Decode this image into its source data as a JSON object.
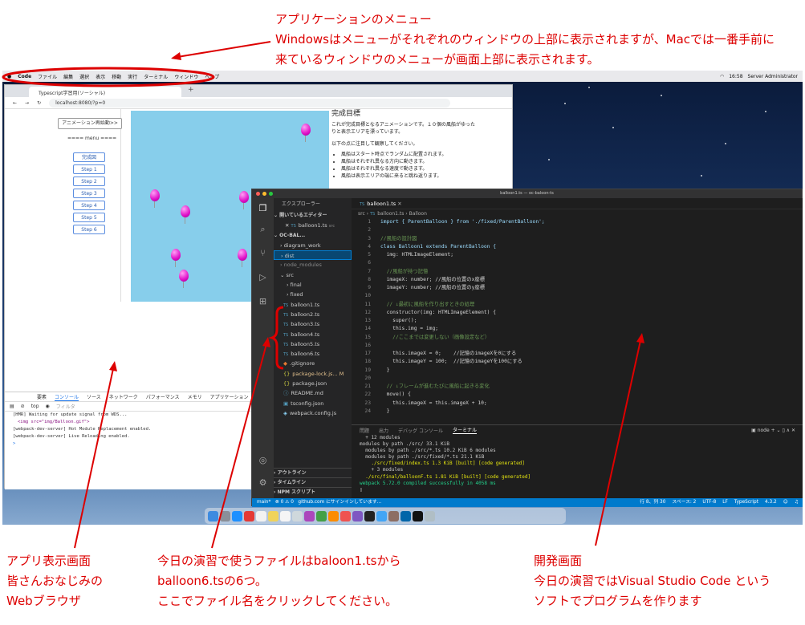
{
  "annotations": {
    "menu_title": "アプリケーションのメニュー",
    "menu_desc1": "Windowsはメニューがそれぞれのウィンドウの上部に表示されますが、Macでは一番手前に",
    "menu_desc2": "来ているウィンドウのメニューが画面上部に表示されます。",
    "browser_line1": "アプリ表示画面",
    "browser_line2": "皆さんおなじみの",
    "browser_line3": "Webブラウザ",
    "files_line1": "今日の演習で使うファイルはbaloon1.tsから",
    "files_line2": "balloon6.tsの6つ。",
    "files_line3": "ここでファイル名をクリックしてください。",
    "dev_line1": "開発画面",
    "dev_line2": "今日の演習ではVisual Studio Code という",
    "dev_line3": "ソフトでプログラムを作ります",
    "accent_color": "#dd0000"
  },
  "menubar": {
    "app": "Code",
    "items": [
      "ファイル",
      "編集",
      "選択",
      "表示",
      "移動",
      "実行",
      "ターミナル",
      "ウィンドウ",
      "ヘルプ"
    ],
    "time": "16:58",
    "user": "Server Administrator"
  },
  "browser": {
    "tab_title": "Typescript学習用(ソーシャル)",
    "url": "localhost:8080/?p=0",
    "restart_button": "アニメーション再始動>>",
    "menu_heading": "==== menu ====",
    "menu_buttons": [
      "完成図",
      "Step 1",
      "Step 2",
      "Step 3",
      "Step 4",
      "Step 5",
      "Step 6"
    ],
    "goal_title": "完成目標",
    "goal_p1": "これが完成目標となるアニメーションです。１０個の風船がゆったりと表示エリアを漂っています。",
    "goal_p2": "以下の点に注目して観察してください。",
    "goal_items": [
      "風船はスタート時点でランダムに配置されます。",
      "風船はそれぞれ異なる方向に動きます。",
      "風船はそれぞれ異なる速度で動きます。",
      "風船は表示エリアの端に来ると跳ね返ります。"
    ],
    "devtools_tabs": [
      "要素",
      "コンソール",
      "ソース",
      "ネットワーク",
      "パフォーマンス",
      "メモリ",
      "アプリケーション"
    ],
    "console_context": "top",
    "console_filter": "フィルタ",
    "console_lines": [
      "[HMR] Waiting for update signal from WDS...",
      "<img src=\"img/Balloon.gif\">",
      "[webpack-dev-server] Hot Module Replacement enabled.",
      "[webpack-dev-server] Live Reloading enabled."
    ]
  },
  "vscode": {
    "window_title": "balloon1.ts — oc-baloon-ts",
    "explorer_title": "エクスプローラー",
    "open_editors": "開いているエディター",
    "open_file": "balloon1.ts",
    "open_file_dir": "src",
    "project": "OC-BAL...",
    "tree": [
      "diagram_work",
      "dist",
      "node_modules",
      "src",
      "final",
      "fixed",
      "balloon1.ts",
      "balloon2.ts",
      "balloon3.ts",
      "balloon4.ts",
      "balloon5.ts",
      "balloon6.ts",
      ".gitignore",
      "package-lock.js...",
      "package.json",
      "README.md",
      "tsconfig.json",
      "webpack.config.js"
    ],
    "outline": "アウトライン",
    "timeline": "タイムライン",
    "npm": "NPM スクリプト",
    "editor_tab": "balloon1.ts",
    "breadcrumb": [
      "src",
      "balloon1.ts",
      "Balloon"
    ],
    "code_lines": [
      "import { ParentBalloon } from './fixed/ParentBalloon';",
      "",
      "//風船の設計図",
      "class Balloon1 extends ParentBalloon {",
      "  img: HTMLImageElement;",
      "",
      "  //風船が持つ記憶",
      "  imageX: number; //風船の位置のx座標",
      "  imageY: number; //風船の位置のy座標",
      "",
      "  // ↓最初に風船を作り出すときの処理",
      "  constructor(img: HTMLImageElement) {",
      "    super();",
      "    this.img = img;",
      "    //ここまでは変更しない（画像設定など）",
      "",
      "    this.imageX = 0;    //記憶のimageXを0にする",
      "    this.imageY = 100;  //記憶のimageYを100にする",
      "  }",
      "",
      "  // ↓フレームが進むたびに風船に起きる変化",
      "  move() {",
      "    this.imageX = this.imageX + 10;",
      "  }"
    ],
    "panel_tabs": [
      "問題",
      "出力",
      "デバッグ コンソール",
      "ターミナル"
    ],
    "terminal_shell": "node",
    "terminal_lines": [
      "  + 12 modules",
      "modules by path ./src/ 33.1 KiB",
      "  modules by path ./src/*.ts 10.2 KiB 6 modules",
      "  modules by path ./src/fixed/*.ts 21.1 KiB",
      "    ./src/fixed/index.ts 1.3 KiB [built] [code generated]",
      "    + 3 modules",
      "  ./src/final/balloonF.ts 1.81 KiB [built] [code generated]",
      "webpack 5.72.0 compiled successfully in 4058 ms",
      ""
    ],
    "status_branch": "main*",
    "status_errors": "⊗ 0 ⚠ 0",
    "status_github": "github.com にサインインしています...",
    "status_pos": "行 8、列 30",
    "status_spaces": "スペース: 2",
    "status_enc": "UTF-8",
    "status_eol": "LF",
    "status_lang": "TypeScript",
    "status_ver": "4.3.2"
  }
}
